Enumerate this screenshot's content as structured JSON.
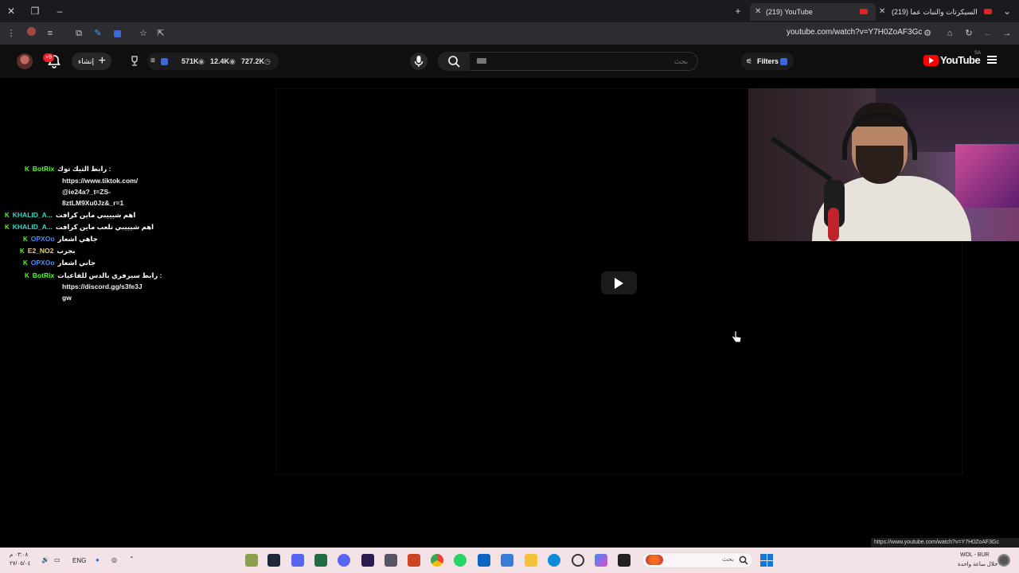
{
  "browser": {
    "tabs": [
      {
        "label": "(219) YouTube",
        "active": true
      },
      {
        "label": "(219) كل السيكرتات والنبات عما",
        "active": false
      }
    ],
    "url": "youtube.com/watch?v=Y7H0ZoAF3Gc",
    "status_url": "https://www.youtube.com/watch?v=Y7H0ZoAF3Gc"
  },
  "youtube": {
    "create_label": "إنشاء",
    "notifications_badge": "+9",
    "stats": {
      "views": "571K",
      "likes": "12.4K",
      "watch": "727.2K"
    },
    "search_placeholder": "بحث",
    "filters_label": "Filters",
    "logo_text": "YouTube",
    "region": "SA"
  },
  "chat": {
    "messages": [
      {
        "user": "BotRix",
        "user_color": "#53fc18",
        "lines": [
          "رابط التيك توك :",
          "https://www.tiktok.com/",
          "@ie24a?_t=ZS-",
          "8ztLM9Xu0Jz&_r=1"
        ]
      },
      {
        "user": "KHALID_A...",
        "user_color": "#3fd8c8",
        "lines": [
          "اهم شيييبي ماين كرافت"
        ]
      },
      {
        "user": "KHALID_A...",
        "user_color": "#3fd8c8",
        "lines": [
          "اهم شيييبي تلعب ماين كرافت"
        ]
      },
      {
        "user": "OPXOo",
        "user_color": "#4a8ff0",
        "lines": [
          "جاهي اشعار"
        ]
      },
      {
        "user": "E2_NO2",
        "user_color": "#e8d66a",
        "lines": [
          "بجرب"
        ]
      },
      {
        "user": "OPXOo",
        "user_color": "#4a8ff0",
        "lines": [
          "جاني اشعار"
        ]
      },
      {
        "user": "BotRix",
        "user_color": "#53fc18",
        "lines": [
          "رابط سيرفري بالدس للفاعيات :",
          "https://discord.gg/s3fe3J",
          "gw"
        ]
      }
    ]
  },
  "taskbar": {
    "time": "٠٣:٠٨ م",
    "date": "٢٧/٠٥/٠٤",
    "language": "ENG",
    "search_placeholder": "بحث",
    "weather_title": "WOL - BUR",
    "weather_sub": "خلال ساعة واحدة"
  },
  "colors": {
    "accent": "#ff0000",
    "kick_green": "#53fc18",
    "taskbar_bg": "#f3e3e7"
  }
}
